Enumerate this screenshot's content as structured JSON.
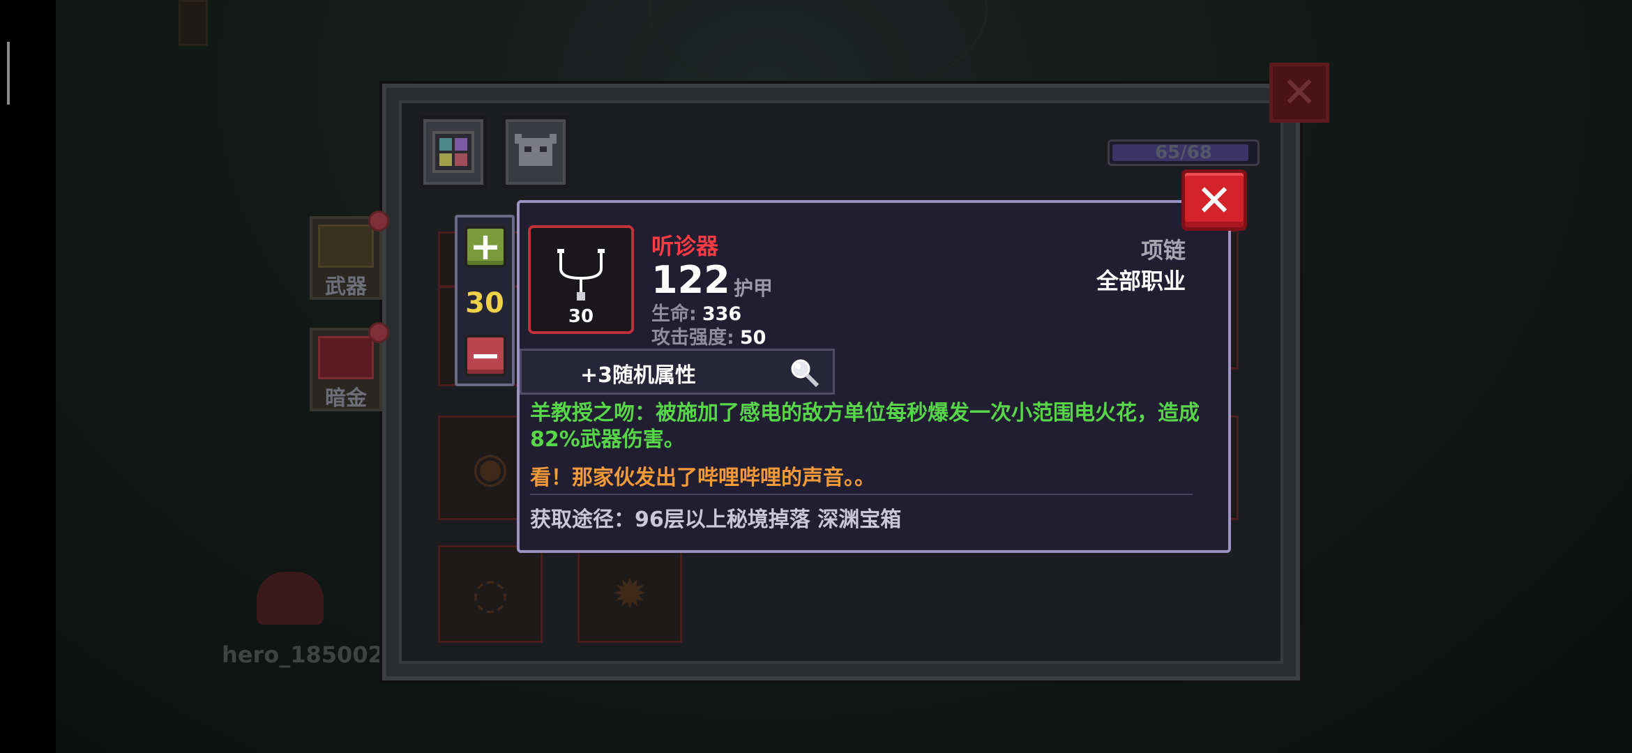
{
  "background": {
    "player_name": "hero_185002"
  },
  "inventory": {
    "capacity_text": "65/68",
    "capacity_fraction": 0.956,
    "side_tabs": [
      {
        "label": "武器"
      },
      {
        "label": "暗金"
      }
    ]
  },
  "stepper": {
    "value": "30",
    "plus": "+",
    "minus": "−"
  },
  "tooltip": {
    "item_name": "听诊器",
    "item_level": "30",
    "armor_value": "122",
    "armor_label": "护甲",
    "stats": [
      {
        "key": "生命:",
        "value": "336"
      },
      {
        "key": "攻击强度:",
        "value": "50"
      }
    ],
    "slot_type": "项链",
    "class_type": "全部职业",
    "random_attr": "+3随机属性",
    "effect_desc": "羊教授之吻：被施加了感电的敌方单位每秒爆发一次小范围电火花，造成82%武器伤害。",
    "flavor_text": "看！那家伙发出了哔哩哔哩的声音。。",
    "source_text": "获取途径：96层以上秘境掉落 深渊宝箱"
  },
  "colors": {
    "item_name": "#ff3b45",
    "effect_text": "#58d64a",
    "flavor_text": "#f29a3a",
    "stepper_value": "#f0d24a",
    "close_button": "#d4232b"
  }
}
